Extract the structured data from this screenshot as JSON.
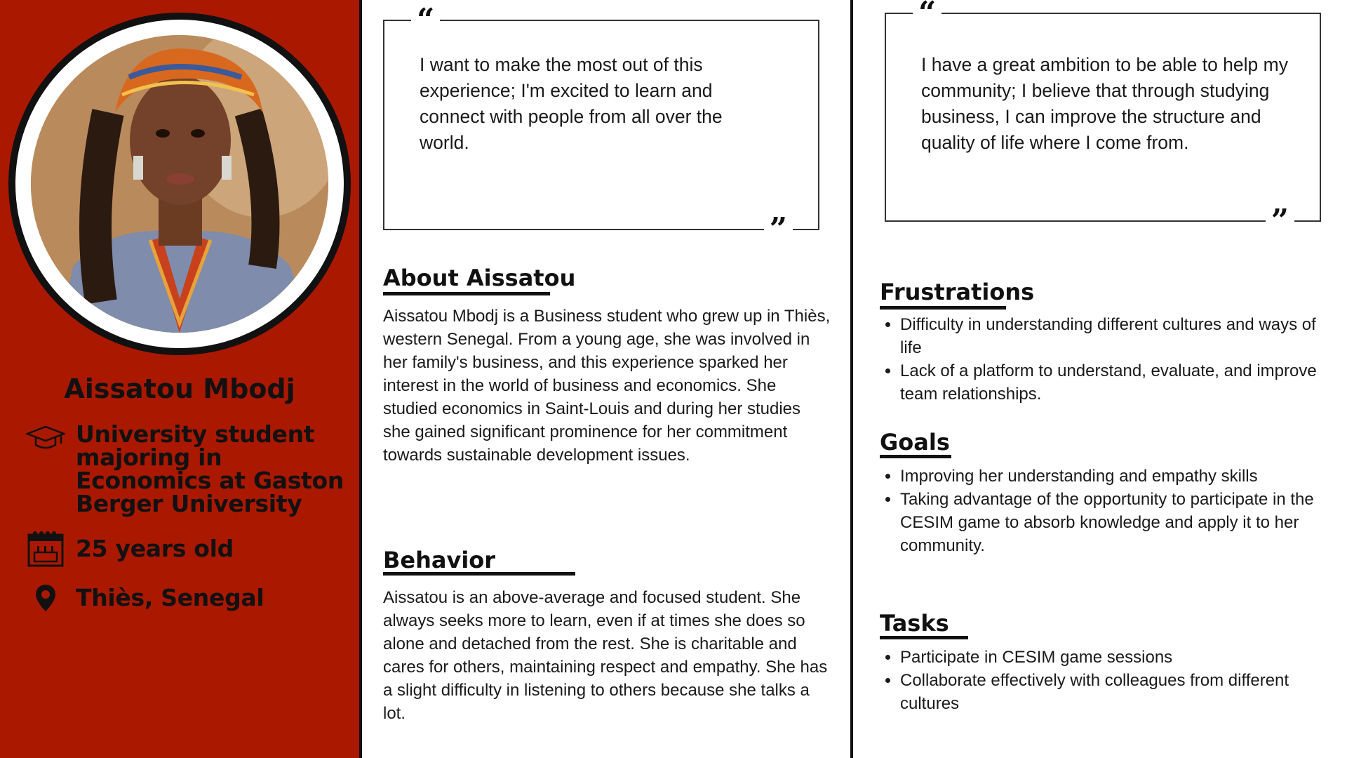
{
  "profile": {
    "name": "Aissatou Mbodj",
    "occupation": "University student majoring in Economics at Gaston Berger University",
    "age": "25 years old",
    "location": "Thiès, Senegal",
    "accent_color": "#ab1800"
  },
  "quotes": [
    {
      "text": "I want to make the most out of this experience; I'm excited to learn and connect with people from all over the world."
    },
    {
      "text": "I have a great ambition to be able to help my community; I believe that through studying business, I can improve the structure and quality of life where I come from."
    }
  ],
  "about": {
    "title": "About Aissatou",
    "text": "Aissatou Mbodj is a Business student who grew up in Thiès, western Senegal. From a young age, she was involved in her family's business, and this experience sparked her interest in the world of business and economics. She studied economics in Saint-Louis and during her studies she gained significant prominence for her commitment towards sustainable development issues."
  },
  "behavior": {
    "title": "Behavior",
    "text": "Aissatou is an above-average and focused student. She always seeks more to learn, even if at times she does so alone and detached from the rest. She is charitable and cares for others, maintaining respect and empathy. She has a slight difficulty in listening to others because she talks a lot."
  },
  "frustrations": {
    "title": "Frustrations",
    "items": [
      "Difficulty in understanding different cultures and ways of life",
      "Lack of a platform to understand, evaluate, and improve team relationships."
    ]
  },
  "goals": {
    "title": "Goals",
    "items": [
      "Improving her understanding and empathy skills",
      "Taking advantage of the opportunity to participate in the CESIM game to absorb knowledge and apply it to her community."
    ]
  },
  "tasks": {
    "title": "Tasks",
    "items": [
      "Participate in CESIM game sessions",
      "Collaborate effectively with colleagues from different cultures"
    ]
  },
  "icons": {
    "occupation": "graduation-cap-icon",
    "age": "birthday-calendar-icon",
    "location": "map-pin-icon"
  }
}
